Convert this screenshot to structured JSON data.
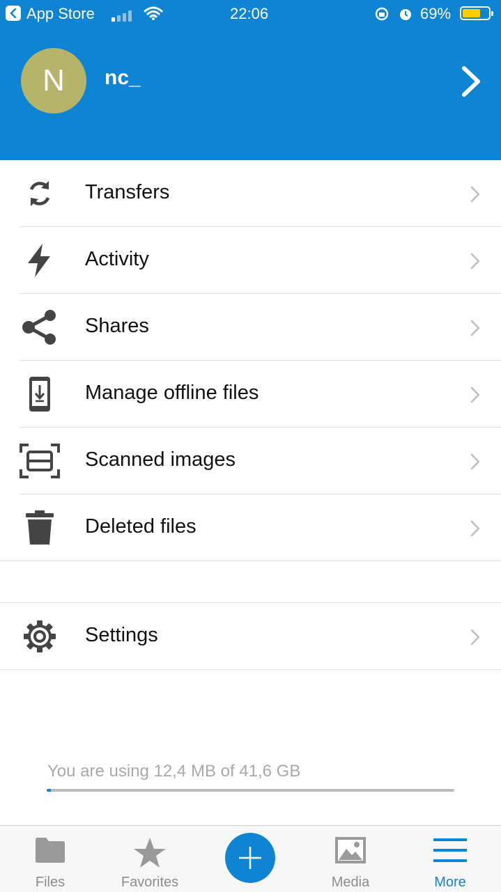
{
  "status_bar": {
    "carrier": "App Store",
    "time": "22:06",
    "battery": "69%",
    "battery_level": 0.69
  },
  "profile": {
    "avatar_letter": "N",
    "username": "nc_"
  },
  "menu": [
    {
      "label": "Transfers",
      "icon": "sync-icon"
    },
    {
      "label": "Activity",
      "icon": "bolt-icon"
    },
    {
      "label": "Shares",
      "icon": "share-icon"
    },
    {
      "label": "Manage offline files",
      "icon": "phone-download-icon"
    },
    {
      "label": "Scanned images",
      "icon": "scan-icon"
    },
    {
      "label": "Deleted files",
      "icon": "trash-icon"
    }
  ],
  "settings": {
    "label": "Settings",
    "icon": "gear-icon"
  },
  "storage": {
    "text": "You are using 12,4 MB of 41,6 GB",
    "used_fraction": 0.01
  },
  "tabs": [
    {
      "label": "Files",
      "icon": "folder-icon"
    },
    {
      "label": "Favorites",
      "icon": "star-icon"
    },
    {
      "label": "Media",
      "icon": "image-icon"
    },
    {
      "label": "More",
      "icon": "menu-icon",
      "active": true
    }
  ],
  "colors": {
    "brand": "#0f84d2",
    "avatar": "#b5b46a",
    "battery": "#ffcc00"
  }
}
